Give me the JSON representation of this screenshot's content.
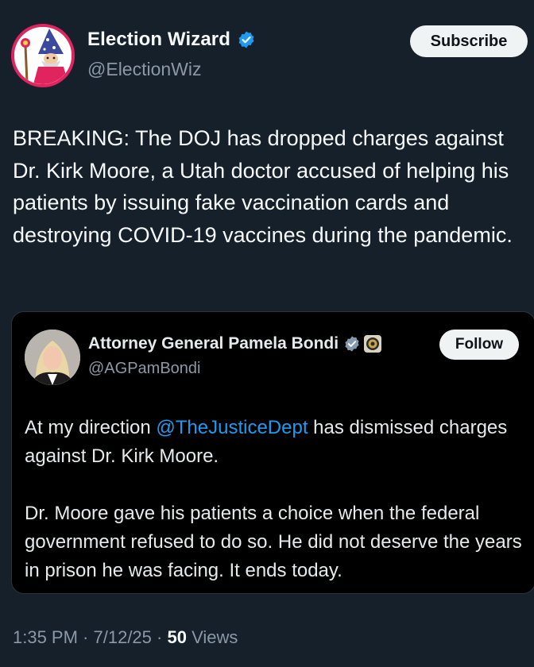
{
  "author": {
    "display_name": "Election Wizard",
    "handle": "@ElectionWiz",
    "verified": true,
    "avatar_icon": "wizard-avatar-icon"
  },
  "subscribe_label": "Subscribe",
  "tweet": {
    "text": "BREAKING: The DOJ has dropped charges against Dr. Kirk Moore, a Utah doctor accused of helping his patients by issuing fake vaccination cards and destroying COVID-19 vaccines during the pandemic."
  },
  "quoted": {
    "display_name": "Attorney General Pamela Bondi",
    "handle": "@AGPamBondi",
    "verified_icon": "verified-gray-icon",
    "affiliation_icon": "doj-seal-icon",
    "follow_label": "Follow",
    "text_before_mention": "At my direction ",
    "mention": "@TheJusticeDept",
    "text_after_mention": " has dismissed charges against Dr. Kirk Moore.",
    "paragraph2": "Dr. Moore gave his patients a choice when the federal government refused to do so. He did not deserve the years in prison he was facing. It ends today."
  },
  "meta": {
    "time": "1:35 PM",
    "date": "7/12/25",
    "separator": " · ",
    "views_count": "50",
    "views_label": " Views"
  },
  "colors": {
    "background": "#15202b",
    "quote_background": "#000000",
    "accent": "#1d9bf0",
    "secondary_text": "#8b98a5"
  }
}
